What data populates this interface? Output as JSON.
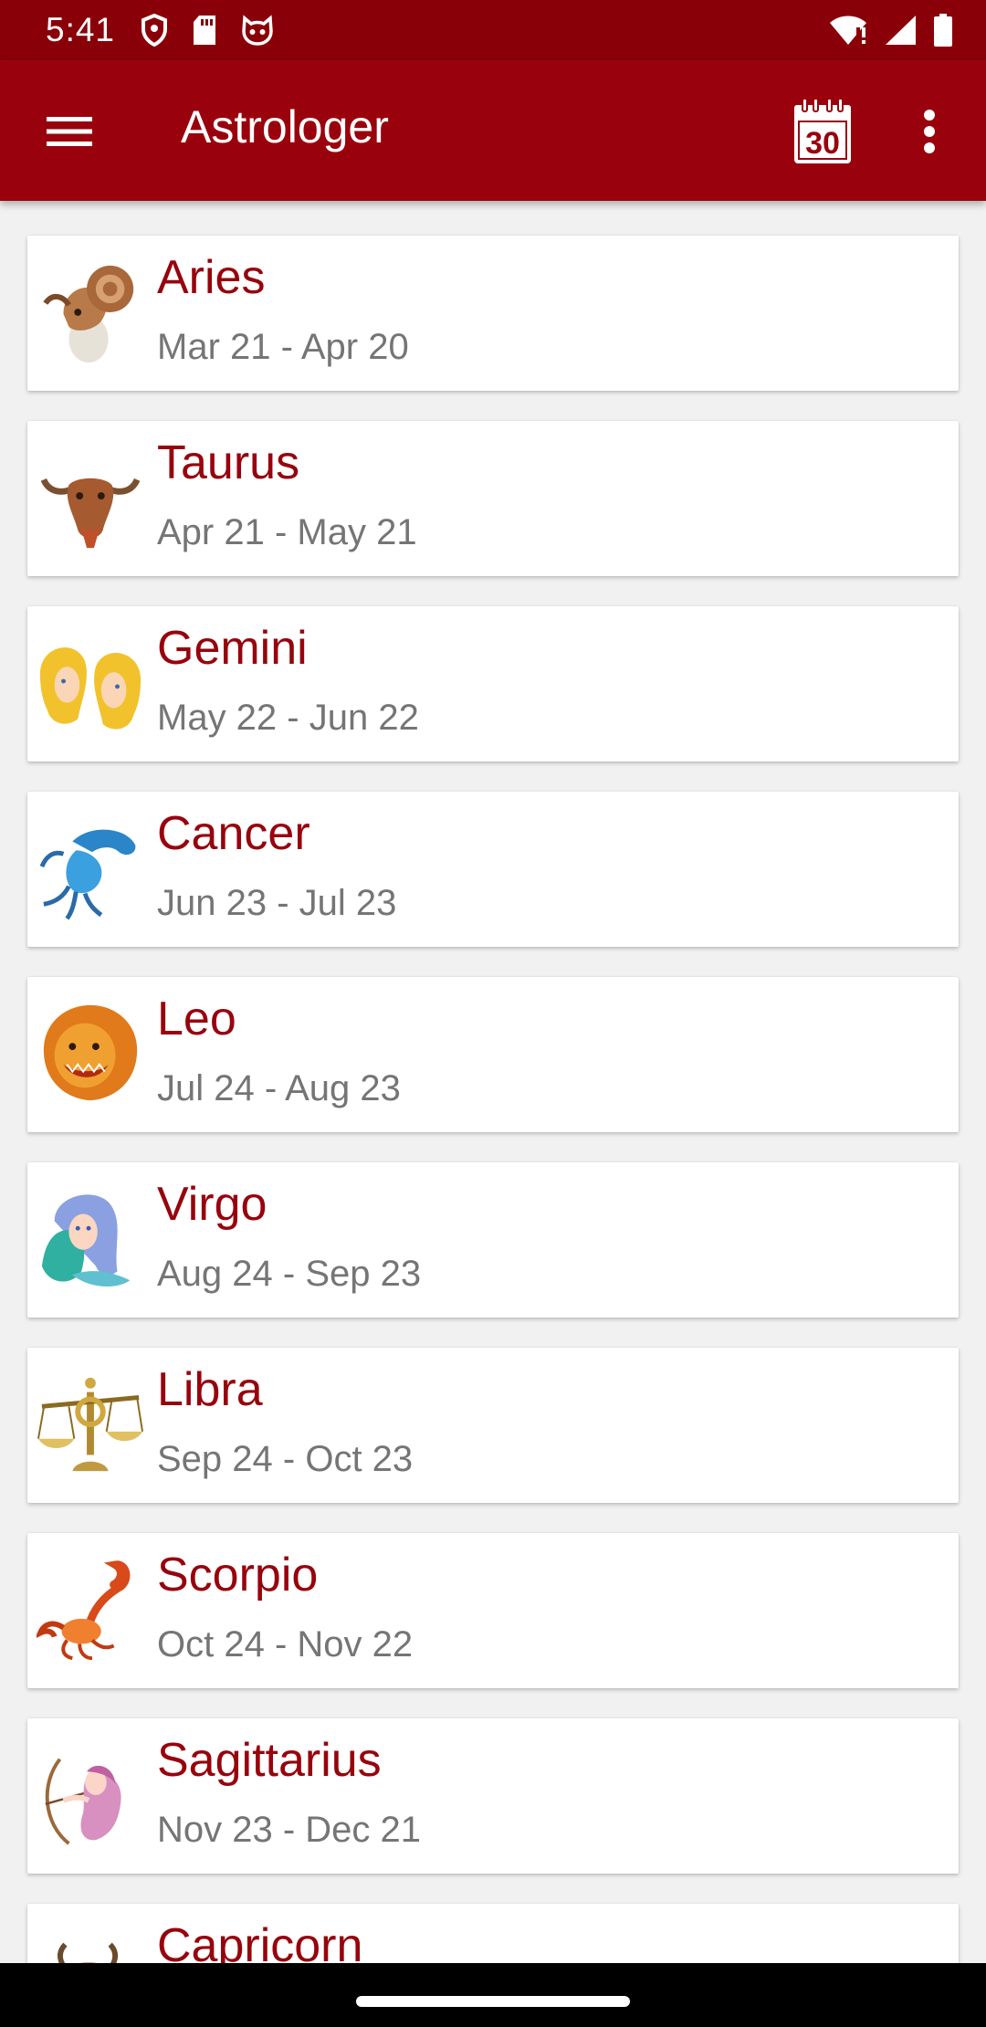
{
  "status_bar": {
    "time": "5:41",
    "left_icons": [
      "shield-icon",
      "sd-card-icon",
      "cat-face-icon"
    ],
    "right_icons": [
      "wifi-alert-icon",
      "signal-icon",
      "battery-icon"
    ]
  },
  "app_bar": {
    "title": "Astrologer",
    "calendar_day": "30",
    "menu_icon": "hamburger-menu-icon",
    "overflow_icon": "more-vertical-icon"
  },
  "colors": {
    "status_bar": "#8a0008",
    "app_bar": "#99020d",
    "accent": "#97030d",
    "secondary_text": "#757575",
    "background": "#f1f1f1"
  },
  "signs": [
    {
      "name": "Aries",
      "dates": "Mar 21 - Apr 20",
      "icon": "aries-ram-icon"
    },
    {
      "name": "Taurus",
      "dates": "Apr 21 - May 21",
      "icon": "taurus-bull-icon"
    },
    {
      "name": "Gemini",
      "dates": "May 22 - Jun 22",
      "icon": "gemini-twins-icon"
    },
    {
      "name": "Cancer",
      "dates": "Jun 23 - Jul 23",
      "icon": "cancer-crab-icon"
    },
    {
      "name": "Leo",
      "dates": "Jul 24 - Aug 23",
      "icon": "leo-lion-icon"
    },
    {
      "name": "Virgo",
      "dates": "Aug 24 - Sep 23",
      "icon": "virgo-maiden-icon"
    },
    {
      "name": "Libra",
      "dates": "Sep 24 - Oct 23",
      "icon": "libra-scales-icon"
    },
    {
      "name": "Scorpio",
      "dates": "Oct 24 - Nov 22",
      "icon": "scorpio-scorpion-icon"
    },
    {
      "name": "Sagittarius",
      "dates": "Nov 23 - Dec 21",
      "icon": "sagittarius-archer-icon"
    },
    {
      "name": "Capricorn",
      "dates": "",
      "icon": "capricorn-goat-icon"
    }
  ]
}
